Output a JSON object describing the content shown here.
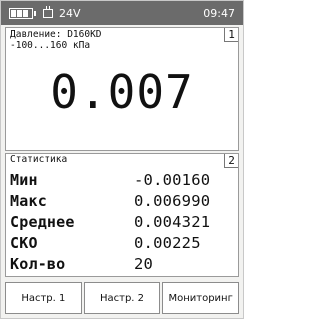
{
  "status_bar": {
    "battery_icon": "battery-icon",
    "power_icon": "plug-icon",
    "voltage": "24V",
    "time": "09:47",
    "background_color": "#6b6b6b"
  },
  "panel1": {
    "number": "1",
    "sensor_line": "Давление: D160KD",
    "range_line": "-100...160 кПа",
    "value": "0.007"
  },
  "panel2": {
    "number": "2",
    "title": "Статистика",
    "rows": [
      {
        "label": "Мин",
        "value": "-0.00160"
      },
      {
        "label": "Макс",
        "value": "0.006990"
      },
      {
        "label": "Среднее",
        "value": "0.004321"
      },
      {
        "label": "СКО",
        "value": "0.00225"
      },
      {
        "label": "Кол-во",
        "value": "20"
      }
    ]
  },
  "buttons": {
    "settings1": "Настр. 1",
    "settings2": "Настр. 2",
    "monitoring": "Мониторинг"
  }
}
